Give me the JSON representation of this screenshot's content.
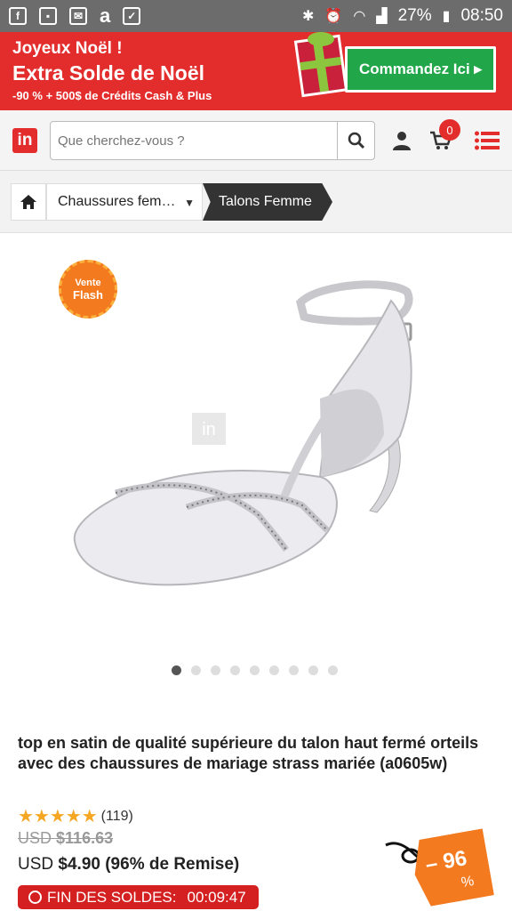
{
  "status_bar": {
    "battery_percent": "27%",
    "time": "08:50",
    "left_icons": [
      "facebook-icon",
      "gallery-icon",
      "message-icon",
      "amazon-icon",
      "shopping-icon"
    ],
    "right_icons": [
      "bluetooth-icon",
      "alarm-icon",
      "wifi-icon",
      "signal-icon",
      "battery-icon"
    ]
  },
  "promo": {
    "line1": "Joyeux Noël !",
    "line2": "Extra Solde de Noël",
    "line3": "-90 % + 500$ de Crédits Cash & Plus",
    "cta_label": "Commandez Ici ▸",
    "colors": {
      "background": "#e32c2c",
      "cta": "#21a64a"
    }
  },
  "header": {
    "logo_text": "in",
    "search_placeholder": "Que cherchez-vous ?",
    "cart_count": "0"
  },
  "breadcrumb": {
    "category": "Chaussures fem…",
    "current": "Talons Femme"
  },
  "product": {
    "flash_badge_line1": "Vente",
    "flash_badge_line2": "Flash",
    "image_watermark": "in",
    "gallery_dots_total": 9,
    "gallery_dot_active": 1,
    "title": "top en satin de qualité supérieure du talon haut fermé orteils avec des chaussures de mariage strass mariée (a0605w)",
    "rating_stars": "★★★★★",
    "rating_value": 5,
    "review_count": "(119)",
    "old_price_currency": "USD",
    "old_price": "$116.63",
    "new_price_currency": "USD",
    "new_price": "$4.90",
    "discount_text": "(96% de Remise)",
    "timer_label": "FIN DES SOLDES:",
    "timer_value": "00:09:47",
    "discount_tag": "– 96",
    "discount_tag_symbol": "%"
  }
}
